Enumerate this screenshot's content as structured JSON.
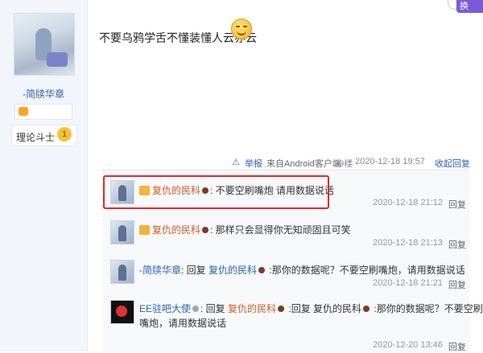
{
  "profile": {
    "username": "-简牍华章",
    "level_title": "理论斗士",
    "level_number": "1"
  },
  "post": {
    "text": "不要乌鸦学舌不懂装懂人云亦云",
    "report_label": "举报",
    "client": "来自Android客户端",
    "floor": "39楼",
    "time": "2020-12-18 19:57",
    "reply_label": "收起回复"
  },
  "top_badge": "换",
  "comments": [
    {
      "user": "复仇的民科",
      "text": ": 不要空刷嘴炮 请用数据说话",
      "time": "2020-12-18 21:12",
      "reply": "回复"
    },
    {
      "user": "复仇的民科",
      "text": ": 那样只会显得你无知顽固且可笑",
      "time": "2020-12-18 21:13",
      "reply": "回复"
    },
    {
      "user": "-简牍华章",
      "prefix": ": 回复 ",
      "target": "复仇的民科",
      "text": " :那你的数据呢？不要空刷嘴炮，请用数据说话",
      "time": "2020-12-18 21:21",
      "reply": "回复"
    },
    {
      "user": "EE驻吧大使",
      "prefix": ": 回复 ",
      "target": "复仇的民科",
      "mid": " :回复 复仇的民科",
      "text": " :那你的数据呢？不要空刷",
      "text2": "嘴炮，请用数据说话",
      "time": "2020-12-20 13:46",
      "reply": "回复"
    }
  ]
}
